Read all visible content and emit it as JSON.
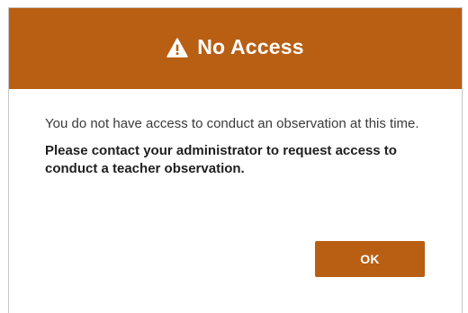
{
  "dialog": {
    "title": "No Access",
    "title_icon": "warning-icon",
    "message": "You do not have access to conduct an observation at this time.",
    "message_strong": "Please contact your administrator to request access to conduct a teacher observation.",
    "ok_label": "OK"
  },
  "colors": {
    "accent": "#b85f14",
    "header_text": "#ffffff",
    "body_text": "#333333"
  }
}
